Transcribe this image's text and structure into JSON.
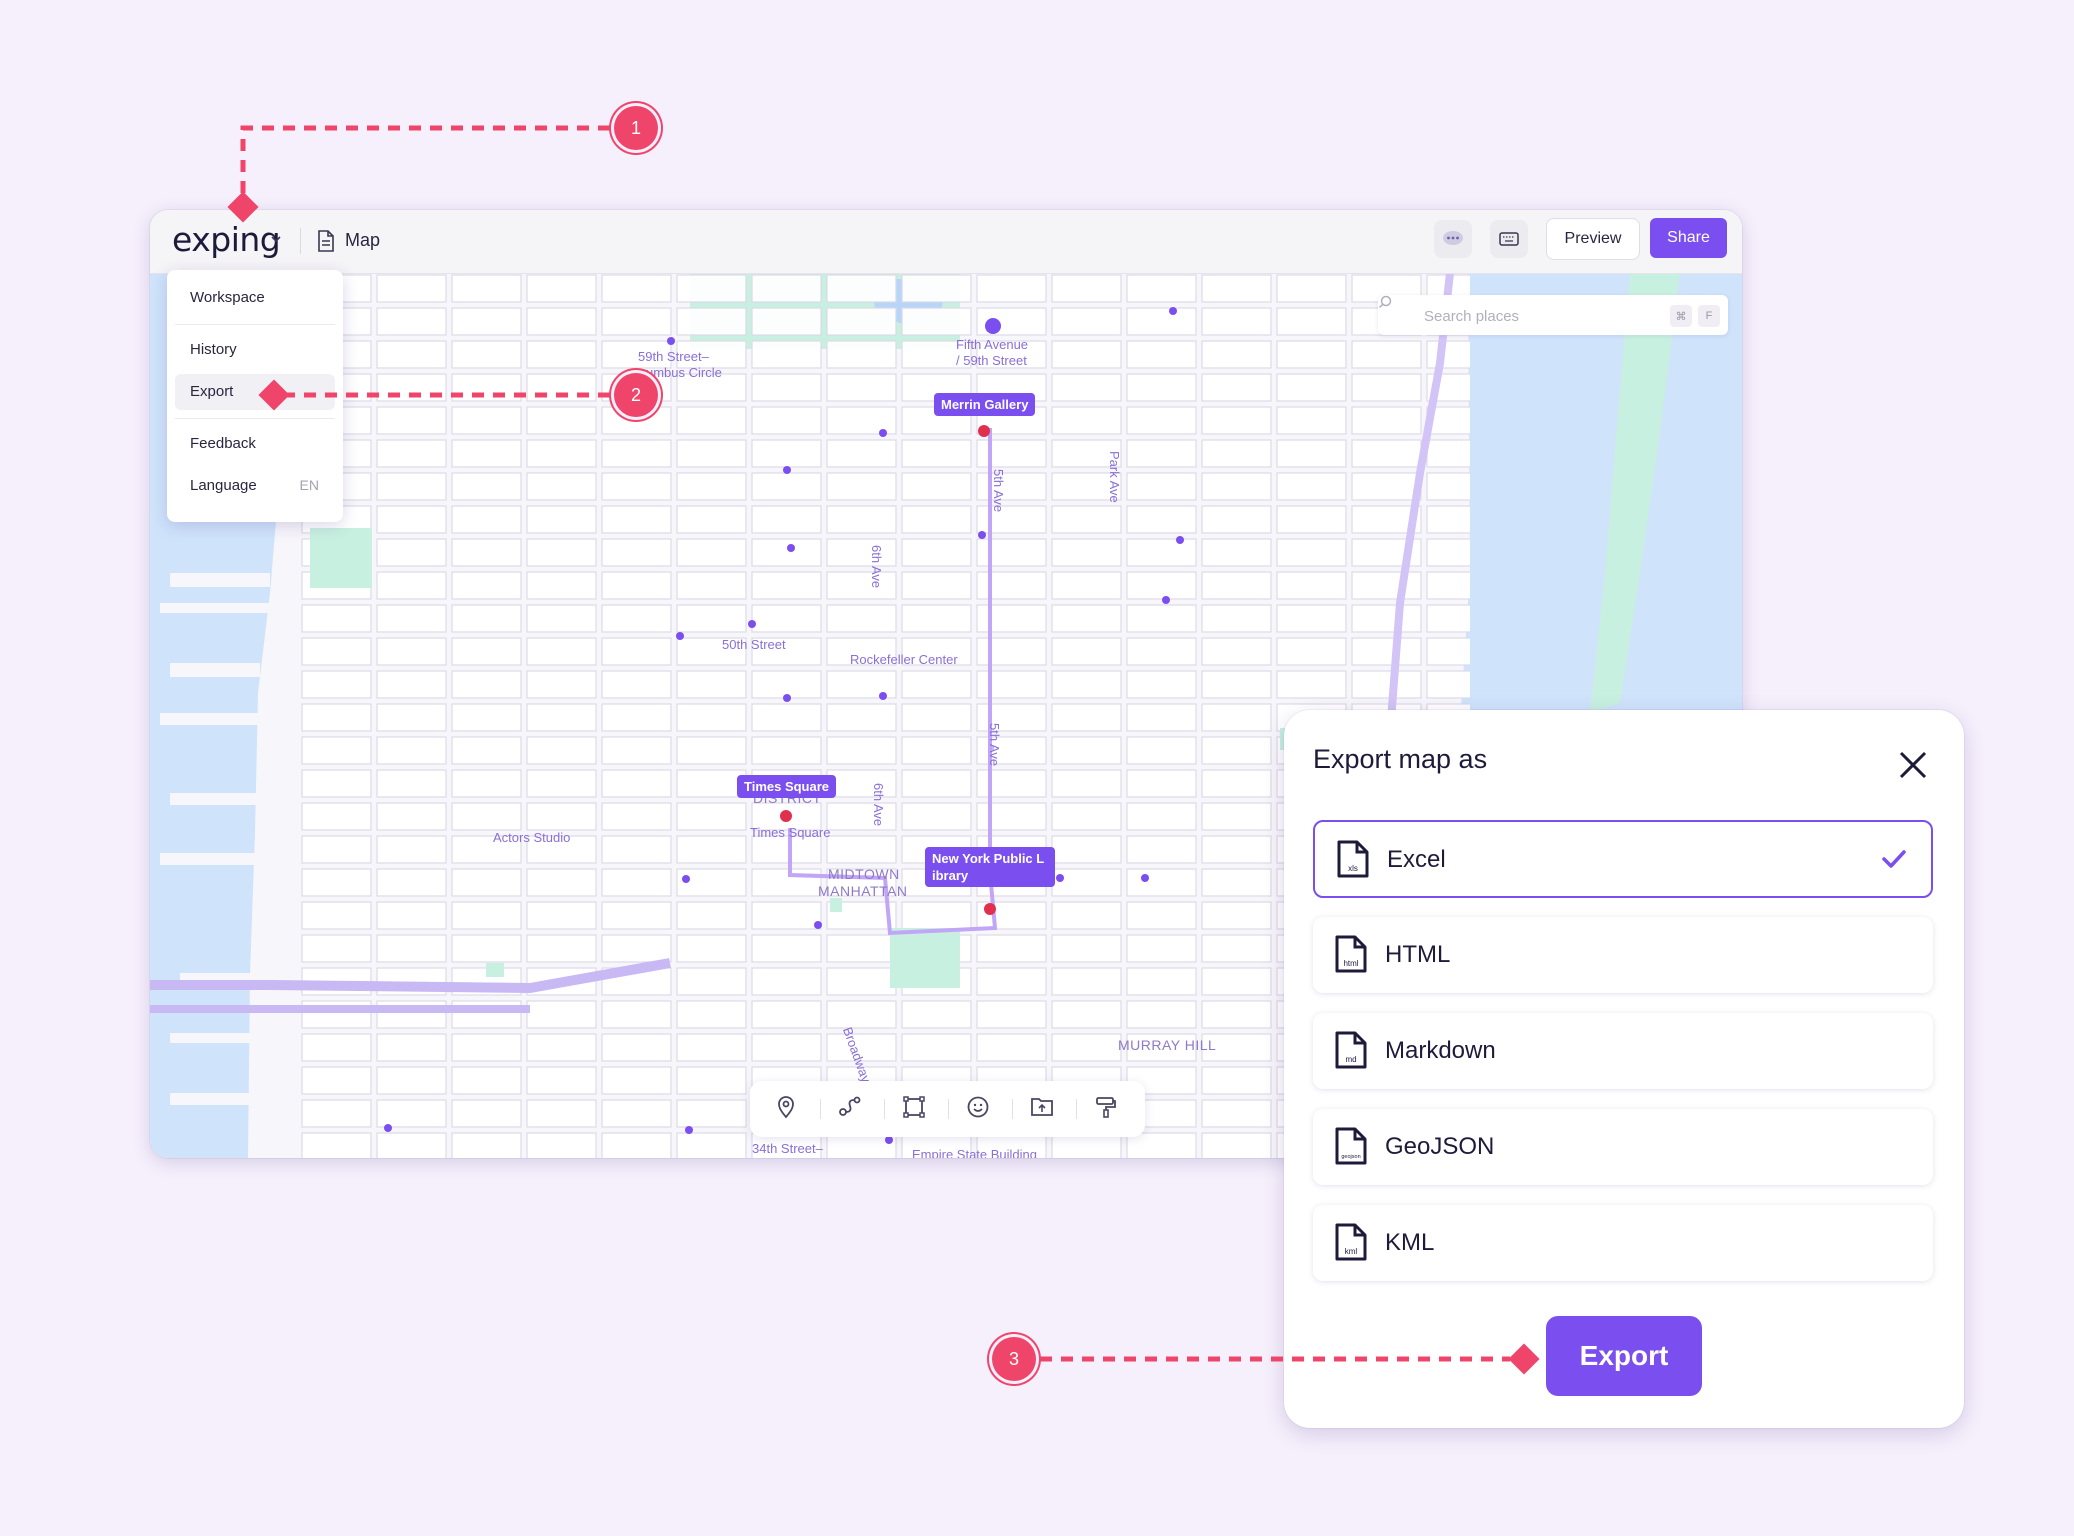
{
  "app": {
    "logo_text": "exping",
    "doc_title": "Map",
    "preview_label": "Preview",
    "share_label": "Share",
    "accent_color": "#7b4ef0"
  },
  "menu": {
    "items": [
      {
        "label": "Workspace"
      },
      {
        "label": "History"
      },
      {
        "label": "Export"
      },
      {
        "label": "Feedback"
      },
      {
        "label": "Language",
        "value": "EN"
      }
    ]
  },
  "map": {
    "search_placeholder": "Search places",
    "search_shortcut": [
      "⌘",
      "F"
    ],
    "pins": [
      "Merrin Gallery",
      "Times Square",
      "New York Public L ibrary"
    ],
    "labels": {
      "station_59": "59th Street–",
      "columbus": "umbus Circle",
      "fifth_ave_1": "Fifth Avenue",
      "fifth_ave_2": "/ 59th Street",
      "fifth_ave_v1": "5th Ave",
      "fifth_ave_v2": "5th Ave",
      "sixth_ave_1": "6th Ave",
      "sixth_ave_2": "6th Ave",
      "park_ave": "Park Ave",
      "fiftieth": "50th Street",
      "rockefeller": "Rockefeller Center",
      "district": "DISTRICT",
      "times_sq": "Times Square",
      "actors": "Actors Studio",
      "midtown_1": "MIDTOWN",
      "midtown_2": "MANHATTAN",
      "murray": "MURRAY HILL",
      "broadway": "Broadway",
      "thirty_fourth": "34th Street–",
      "empire": "Empire State Building"
    },
    "toolbar_tools": [
      "pin-icon",
      "route-icon",
      "area-icon",
      "emoji-icon",
      "upload-icon",
      "paint-roller-icon"
    ]
  },
  "dialog": {
    "title": "Export map as",
    "options": [
      {
        "label": "Excel",
        "ext": "xls",
        "selected": true
      },
      {
        "label": "HTML",
        "ext": "html",
        "selected": false
      },
      {
        "label": "Markdown",
        "ext": "md",
        "selected": false
      },
      {
        "label": "GeoJSON",
        "ext": "geojson",
        "selected": false
      },
      {
        "label": "KML",
        "ext": "kml",
        "selected": false
      }
    ],
    "export_label": "Export"
  },
  "annotations": {
    "steps": [
      "1",
      "2",
      "3"
    ],
    "color": "#f0456a"
  }
}
